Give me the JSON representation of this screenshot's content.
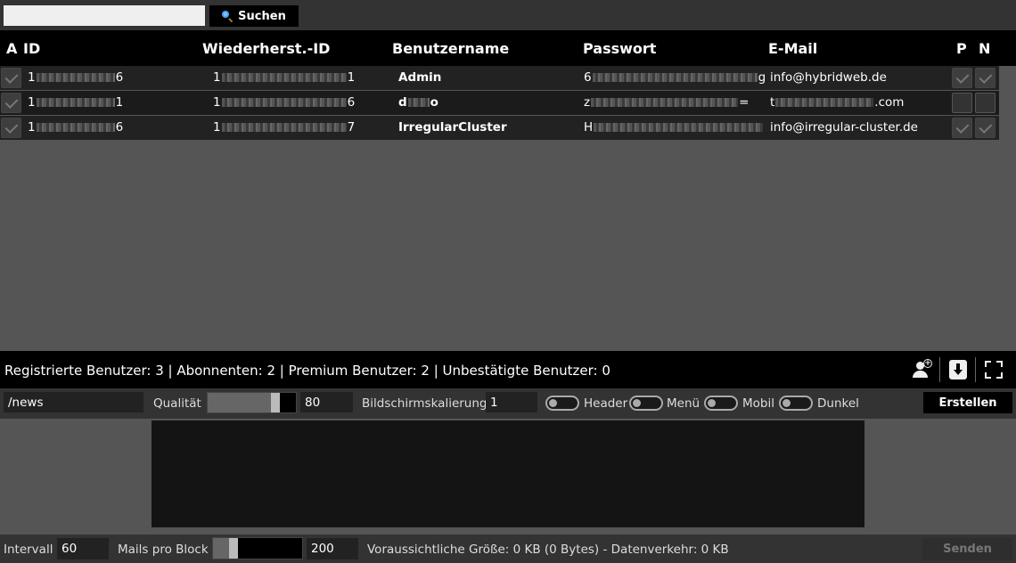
{
  "search": {
    "value": "",
    "button_label": "Suchen"
  },
  "table": {
    "columns": {
      "a": "A",
      "id": "ID",
      "recovery_id": "Wiederherst.-ID",
      "username": "Benutzername",
      "password": "Passwort",
      "email": "E-Mail",
      "p": "P",
      "n": "N"
    },
    "rows": [
      {
        "a": true,
        "id_start": "1",
        "id_end": "6",
        "rec_start": "1",
        "rec_end": "1",
        "username": "Admin",
        "pw_start": "6",
        "pw_end": "g",
        "email_start": "info@hybridweb.de",
        "email_end": "",
        "p": true,
        "n": true
      },
      {
        "a": true,
        "id_start": "1",
        "id_end": "1",
        "rec_start": "1",
        "rec_end": "6",
        "username": "d",
        "username_end": "o",
        "pw_start": "z",
        "pw_end": "=",
        "email_start": "t",
        "email_end": ".com",
        "p": false,
        "n": false
      },
      {
        "a": true,
        "id_start": "1",
        "id_end": "6",
        "rec_start": "1",
        "rec_end": "7",
        "username": "IrregularCluster",
        "pw_start": "H",
        "pw_end": "",
        "email_start": "info@irregular-cluster.de",
        "email_end": "",
        "p": true,
        "n": true
      }
    ]
  },
  "status": {
    "text": "Registrierte Benutzer: 3 | Abonnenten: 2 | Premium Benutzer: 2 | Unbestätigte Benutzer: 0",
    "icons": [
      "add-user-icon",
      "download-icon",
      "fullscreen-icon"
    ]
  },
  "settings": {
    "path_value": "/news",
    "quality_label": "Qualität",
    "quality_value": "80",
    "quality_fraction": 0.8,
    "scaling_label": "Bildschirmskalierung",
    "scaling_value": "1",
    "toggle_header": "Header",
    "toggle_menu": "Menü",
    "toggle_mobile": "Mobil",
    "toggle_dark": "Dunkel",
    "create_label": "Erstellen"
  },
  "bottom": {
    "interval_label": "Intervall",
    "interval_value": "60",
    "mails_label": "Mails pro Block",
    "mails_value": "200",
    "mails_fraction": 0.2,
    "size_text": "Voraussichtliche Größe: 0 KB (0 Bytes) - Datenverkehr: 0 KB",
    "send_label": "Senden"
  }
}
